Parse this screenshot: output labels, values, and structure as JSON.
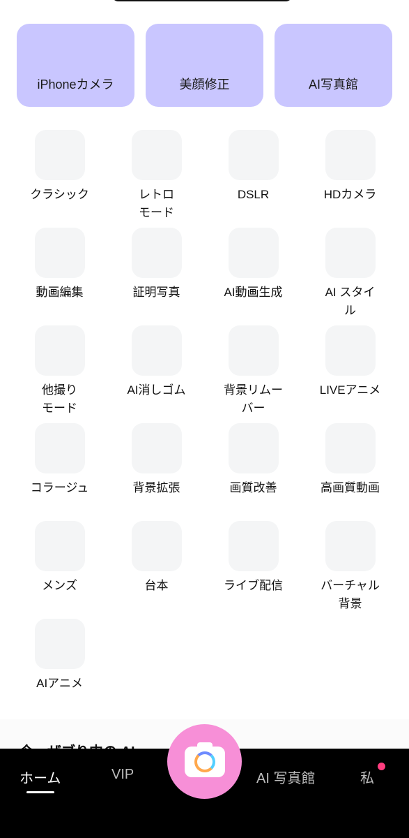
{
  "top_cards": [
    {
      "label": "iPhoneカメラ"
    },
    {
      "label": "美顔修正"
    },
    {
      "label": "AI写真館"
    }
  ],
  "tools": [
    {
      "label": "クラシック"
    },
    {
      "label": "レトロ\nモード"
    },
    {
      "label": "DSLR"
    },
    {
      "label": "HDカメラ"
    },
    {
      "label": "動画編集"
    },
    {
      "label": "証明写真"
    },
    {
      "label": "AI動画生成"
    },
    {
      "label": "AI スタイ\nル"
    },
    {
      "label": "他撮り\nモード"
    },
    {
      "label": "AI消しゴム"
    },
    {
      "label": "背景リムー\nバー"
    },
    {
      "label": "LIVEアニメ"
    },
    {
      "label": "コラージュ"
    },
    {
      "label": "背景拡張"
    },
    {
      "label": "画質改善"
    },
    {
      "label": "高画質動画"
    },
    {
      "label": "メンズ"
    },
    {
      "label": "台本"
    },
    {
      "label": "ライブ配信"
    },
    {
      "label": "バーチャル\n背景"
    },
    {
      "label": "AIアニメ"
    }
  ],
  "section_peek": {
    "text": "今、ザブり中の AI..."
  },
  "tabbar": {
    "home": "ホーム",
    "vip": "VIP",
    "ai_studio": "AI 写真館",
    "me": "私",
    "me_has_notification": true,
    "camera_icon": "camera-icon"
  },
  "colors": {
    "card_bg": "#c9c6ff",
    "tile_bg": "#f4f5f6",
    "camera_button": "#f78fd7",
    "tabbar_bg": "#000000",
    "notification_dot": "#ff3d7f"
  }
}
